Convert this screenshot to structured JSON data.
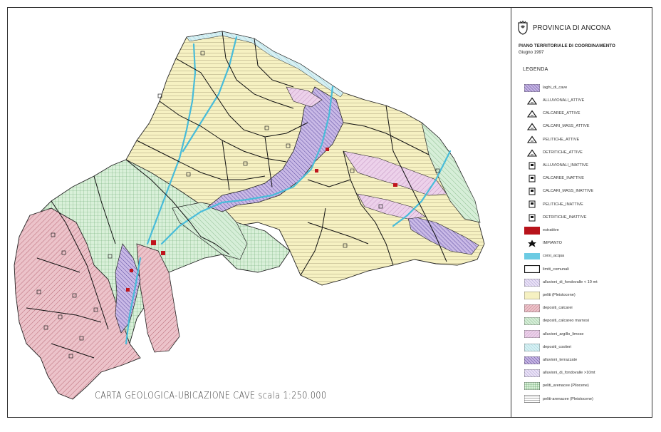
{
  "map": {
    "title": "CARTA GEOLOGICA-UBICAZIONE CAVE scala 1:250.000",
    "colors": {
      "pelitic_yellow": "#f6f1c2",
      "calcareous_pink": "#e7b3bd",
      "calcareous_marl_green": "#d2ecd3",
      "clay_lavender": "#e7c6e3",
      "alluvial_purple": "#c7b5e3",
      "river_cyan": "#7fd2e6",
      "boundary": "#111111",
      "active_quarry_red": "#c0141c"
    }
  },
  "legend": {
    "province": "PROVINCIA DI ANCONA",
    "plan_title": "PIANO TERRITORIALE DI COORDINAMENTO",
    "plan_date": "Giugno 1997",
    "heading": "LEGENDA",
    "items": [
      {
        "label": "laghi_di_cave",
        "icon": "hatch-purple"
      },
      {
        "label": "ALLUVIONALI_ATTIVE",
        "icon": "triangle"
      },
      {
        "label": "CALCAREE_ATTIVE",
        "icon": "triangle"
      },
      {
        "label": "CALCARI_MASS_ATTIVE",
        "icon": "triangle"
      },
      {
        "label": "PELITICHE_ATTIVE",
        "icon": "triangle"
      },
      {
        "label": "DETRITICHE_ATTIVE",
        "icon": "triangle"
      },
      {
        "label": "ALLUVIONALI_INATTIVE",
        "icon": "square"
      },
      {
        "label": "CALCAREE_INATTIVE",
        "icon": "square"
      },
      {
        "label": "CALCARI_MASS_INATTIVE",
        "icon": "square"
      },
      {
        "label": "PELITICHE_INATTIVE",
        "icon": "square"
      },
      {
        "label": "DETRITICHE_INATTIVE",
        "icon": "square"
      },
      {
        "label": "estrattive",
        "icon": "red-block"
      },
      {
        "label": "IMPIANTO",
        "icon": "star"
      },
      {
        "label": "corsi_acqua",
        "icon": "cyan-block"
      },
      {
        "label": "limiti_comunali",
        "icon": "outline-box"
      },
      {
        "label": "alluvioni_di_fondovalle < 10 mt",
        "icon": "hatch-purple-light"
      },
      {
        "label": "peliti (Pleistocene)",
        "icon": "yellow-block"
      },
      {
        "label": "depositi_calcarei",
        "icon": "hatch-pink"
      },
      {
        "label": "depositi_calcareo marnosi",
        "icon": "hatch-green"
      },
      {
        "label": "alluvioni_argillo_limose",
        "icon": "hatch-lavender"
      },
      {
        "label": "depositi_costieri",
        "icon": "hatch-cyan"
      },
      {
        "label": "alluvioni_terrazzate",
        "icon": "hatch-purple-dark"
      },
      {
        "label": "alluvioni_di_fondovalle >10mt",
        "icon": "hatch-purple-light"
      },
      {
        "label": "peliti_arenacee (Pliocene)",
        "icon": "grid-green"
      },
      {
        "label": "peliti-arenacee (Pleistocene)",
        "icon": "hlines"
      }
    ]
  }
}
